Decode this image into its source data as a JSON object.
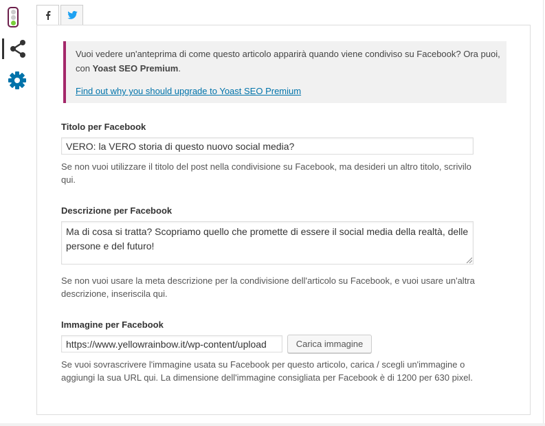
{
  "sidebar": {
    "items": [
      {
        "icon": "traffic-light-icon",
        "active": false
      },
      {
        "icon": "share-icon",
        "active": true
      },
      {
        "icon": "gear-icon",
        "active": false
      }
    ],
    "colors": {
      "brand": "#a4286a",
      "icon_blue": "#0073aa",
      "dot_green": "#7ad03a"
    }
  },
  "tabs": [
    {
      "icon": "facebook-icon",
      "active": true
    },
    {
      "icon": "twitter-icon",
      "active": false
    }
  ],
  "notice": {
    "text_before": "Vuoi vedere un'anteprima di come questo articolo apparirà quando viene condiviso su Facebook? Ora puoi, con ",
    "text_strong": "Yoast SEO Premium",
    "text_after": ".",
    "link": "Find out why you should upgrade to Yoast SEO Premium"
  },
  "fields": {
    "title": {
      "label": "Titolo per Facebook",
      "value": "VERO: la VERO storia di questo nuovo social media?",
      "help": "Se non vuoi utilizzare il titolo del post nella condivisione su Facebook, ma desideri un altro titolo, scrivilo qui."
    },
    "description": {
      "label": "Descrizione per Facebook",
      "value": "Ma di cosa si tratta? Scopriamo quello che promette di essere il social media della realtà, delle persone e del futuro!",
      "help": "Se non vuoi usare la meta descrizione per la condivisione dell'articolo su Facebook, e vuoi usare un'altra descrizione, inseriscila qui."
    },
    "image": {
      "label": "Immagine per Facebook",
      "value": "https://www.yellowrainbow.it/wp-content/upload",
      "button": "Carica immagine",
      "help": "Se vuoi sovrascrivere l'immagine usata su Facebook per questo articolo, carica / scegli un'immagine o aggiungi la sua URL qui. La dimensione dell'immagine consigliata per Facebook è di 1200 per 630 pixel."
    }
  }
}
